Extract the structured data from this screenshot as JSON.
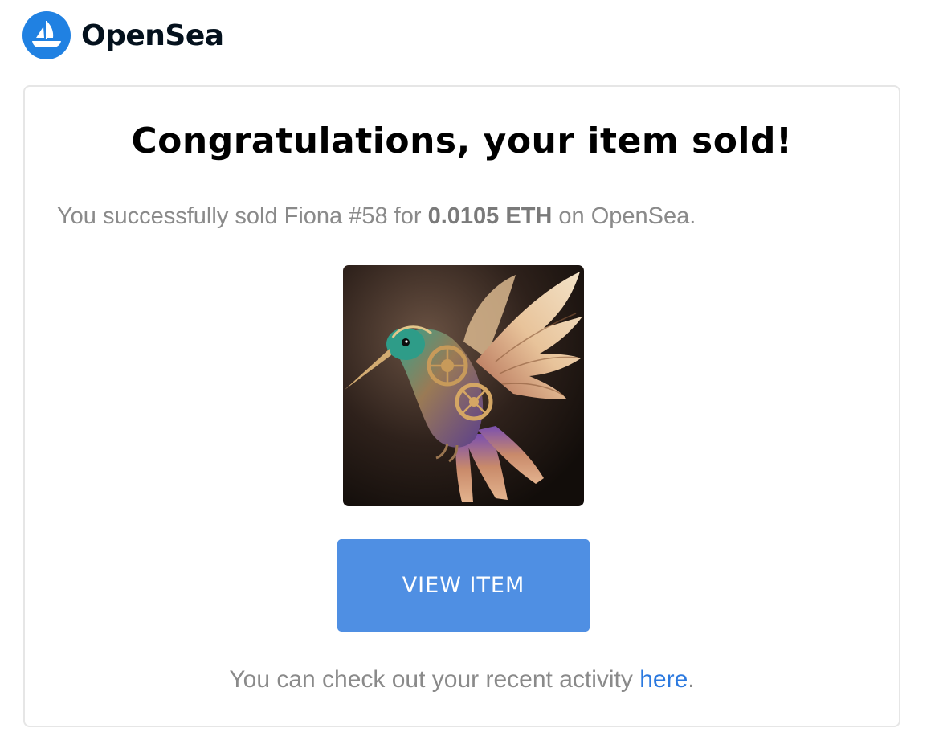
{
  "brand": {
    "name": "OpenSea",
    "logo_icon": "sailboat-icon",
    "logo_color": "#2081e2"
  },
  "email": {
    "headline": "Congratulations, your item sold!",
    "sold_prefix": "You successfully sold Fiona #58 for",
    "sold_price": "0.0105 ETH",
    "sold_suffix": "on OpenSea.",
    "nft_image": "steampunk-hummingbird-artwork",
    "button_label": "VIEW ITEM",
    "button_color": "#4f8fe3",
    "activity_prefix": "You can check out your recent activity",
    "activity_link": "here",
    "activity_suffix": "."
  }
}
